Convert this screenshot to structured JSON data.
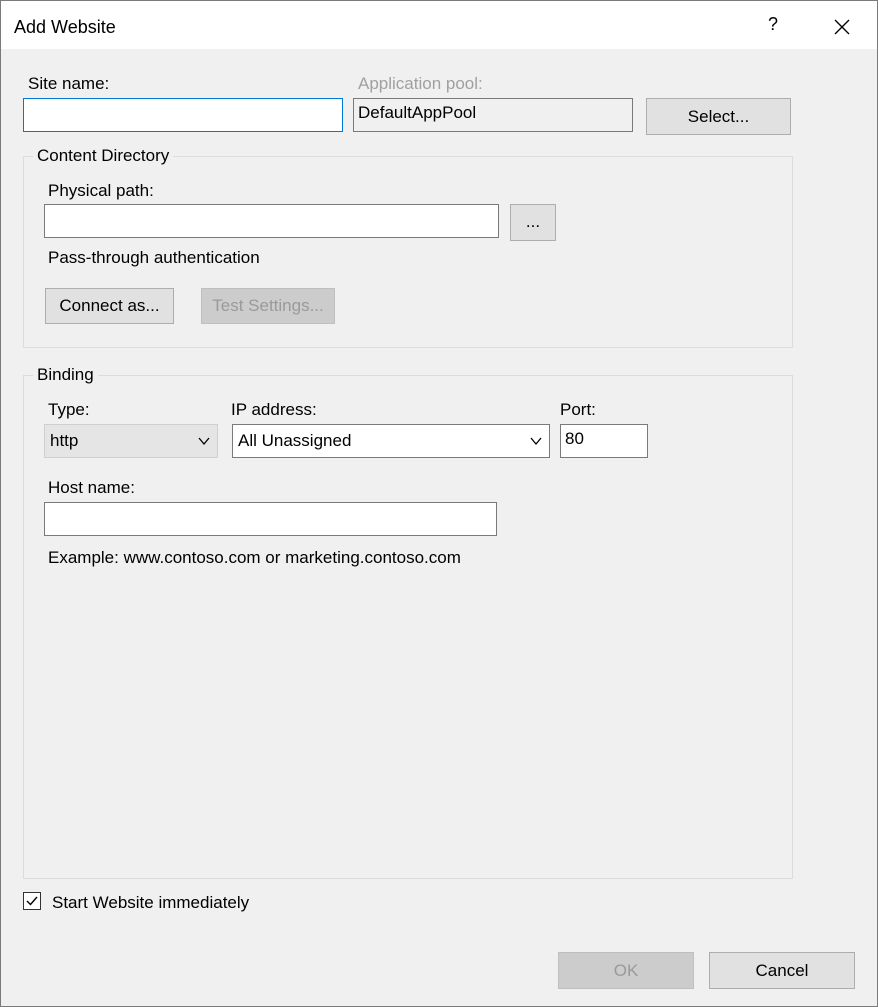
{
  "window": {
    "title": "Add Website",
    "help_glyph": "?"
  },
  "site": {
    "site_name_label": "Site name:",
    "site_name_value": "",
    "app_pool_label": "Application pool:",
    "app_pool_value": "DefaultAppPool",
    "select_button": "Select..."
  },
  "content_directory": {
    "legend": "Content Directory",
    "physical_path_label": "Physical path:",
    "physical_path_value": "",
    "browse_button": "...",
    "passthrough_label": "Pass-through authentication",
    "connect_as_button": "Connect as...",
    "test_settings_button": "Test Settings..."
  },
  "binding": {
    "legend": "Binding",
    "type_label": "Type:",
    "type_value": "http",
    "ip_label": "IP address:",
    "ip_value": "All Unassigned",
    "port_label": "Port:",
    "port_value": "80",
    "host_label": "Host name:",
    "host_value": "",
    "example_text": "Example: www.contoso.com or marketing.contoso.com"
  },
  "start_immediately": {
    "label": "Start Website immediately",
    "checked": true
  },
  "footer": {
    "ok_button": "OK",
    "cancel_button": "Cancel"
  },
  "icons": {
    "help": "help-icon",
    "close": "close-icon",
    "dropdown": "chevron-down-icon",
    "checkbox": "checkmark-icon"
  },
  "colors": {
    "focus_border": "#0078d7",
    "dialog_bg": "#f0f0f0",
    "titlebar_bg": "#ffffff",
    "disabled_text": "#9a9a9a"
  }
}
